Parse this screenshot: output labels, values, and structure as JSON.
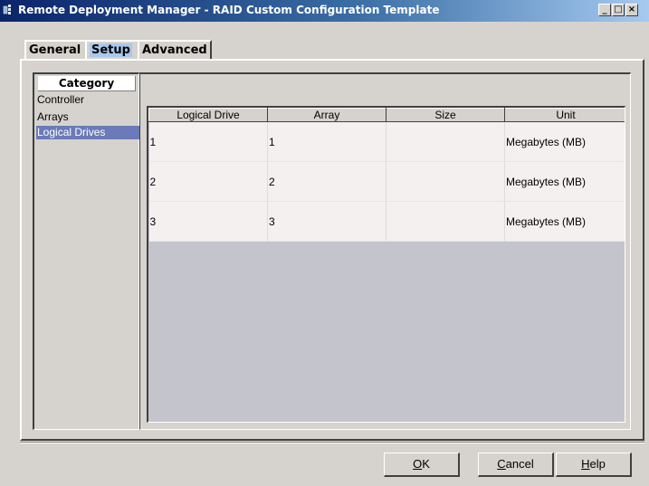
{
  "window": {
    "title": "Remote Deployment Manager - RAID Custom Configuration Template",
    "min_btn": "_",
    "max_btn": "□",
    "close_btn": "×"
  },
  "tabs": [
    {
      "label": "General",
      "active": false
    },
    {
      "label": "Setup",
      "active": true
    },
    {
      "label": "Advanced",
      "active": false
    }
  ],
  "category": {
    "header": "Category",
    "items": [
      "Controller",
      "Arrays",
      "Logical Drives"
    ],
    "selected": "Logical Drives"
  },
  "table": {
    "columns": [
      "Logical Drive",
      "Array",
      "Size",
      "Unit"
    ],
    "rows": [
      [
        "1",
        "1",
        "",
        "Megabytes (MB)"
      ],
      [
        "2",
        "2",
        "",
        "Megabytes (MB)"
      ],
      [
        "3",
        "3",
        "",
        "Megabytes (MB)"
      ]
    ]
  },
  "buttons": {
    "ok_mnemonic": "O",
    "ok_rest": "K",
    "cancel_mnemonic": "C",
    "cancel_rest": "ancel",
    "help_mnemonic": "H",
    "help_rest": "elp"
  },
  "colors": {
    "title_gradient_start": "#0a246a",
    "selection": "#6b7ab8",
    "active_tab": "#a8c8ee"
  }
}
